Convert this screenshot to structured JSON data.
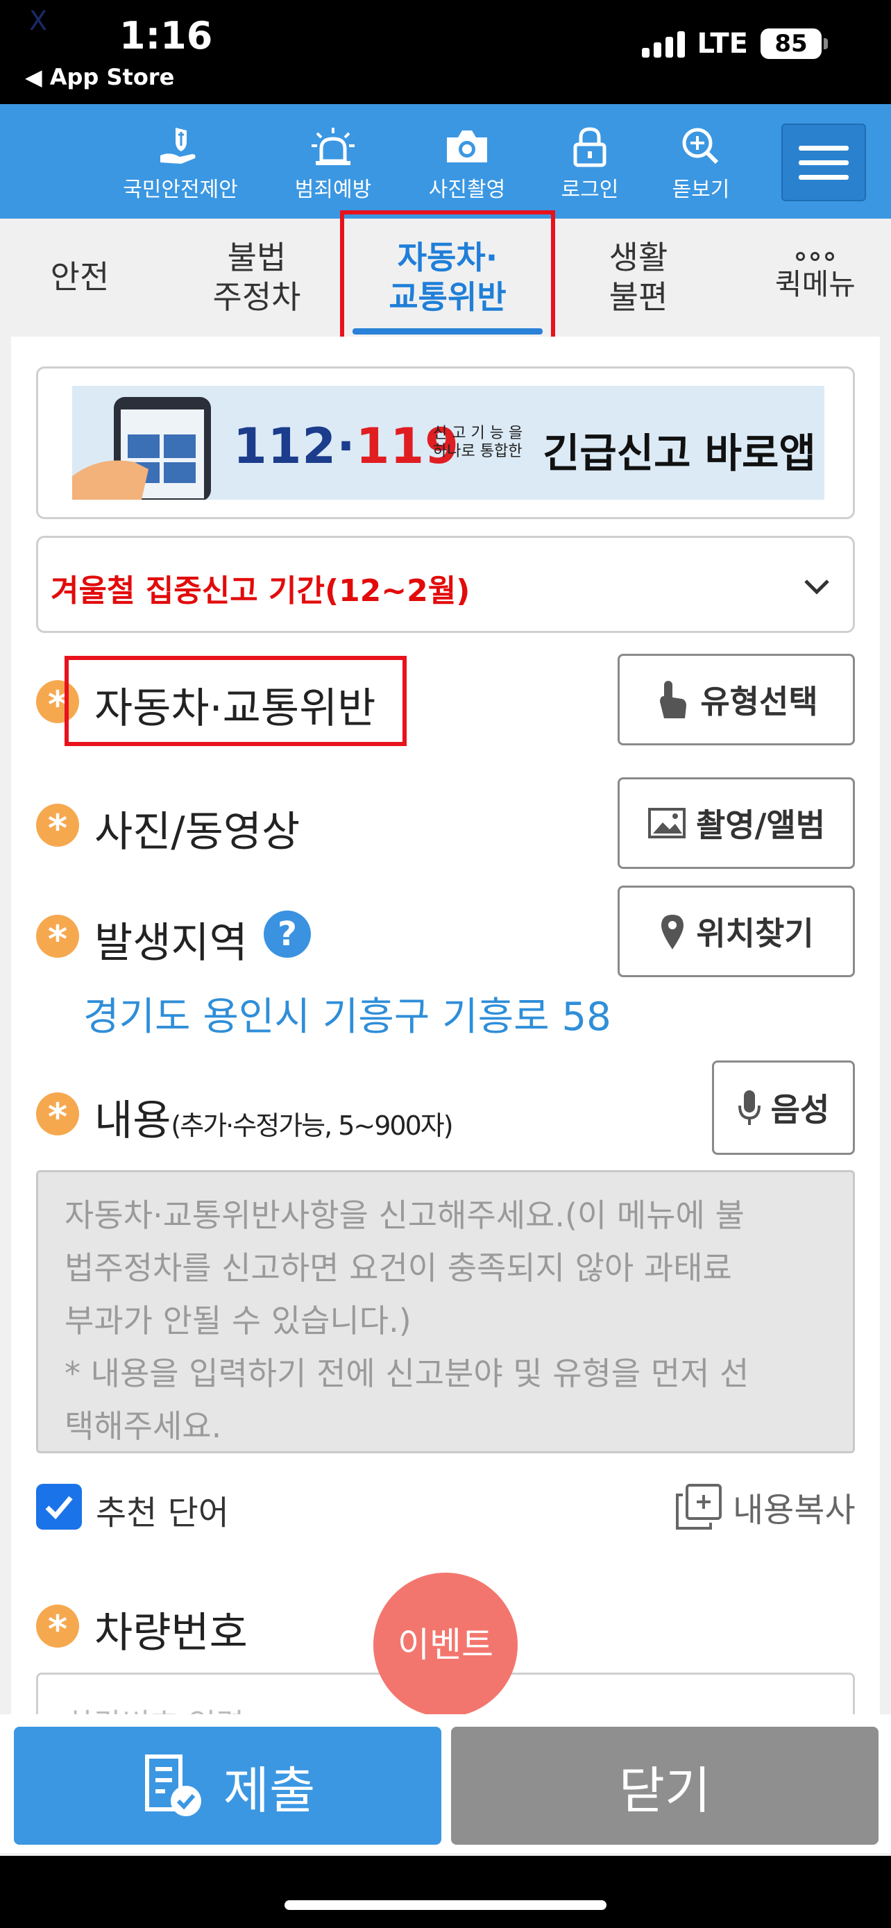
{
  "status_bar": {
    "time": "1:16",
    "back_label": "◀ App Store",
    "network": "LTE",
    "battery": "85",
    "corner_mark": "X"
  },
  "toolbar": {
    "items": [
      {
        "label": "국민안전제안",
        "icon": "hand-shield-icon"
      },
      {
        "label": "범죄예방",
        "icon": "siren-icon"
      },
      {
        "label": "사진촬영",
        "icon": "camera-icon"
      },
      {
        "label": "로그인",
        "icon": "lock-icon"
      },
      {
        "label": "돋보기",
        "icon": "magnifier-plus-icon"
      }
    ],
    "menu_icon": "hamburger-menu-icon"
  },
  "tabs": [
    {
      "label": "안전"
    },
    {
      "label_line1": "불법",
      "label_line2": "주정차"
    },
    {
      "label_line1": "자동차·",
      "label_line2": "교통위반",
      "active": true
    },
    {
      "label_line1": "생활",
      "label_line2": "불편"
    },
    {
      "label": "퀵메뉴",
      "icon": "more-dots-icon"
    }
  ],
  "banner": {
    "num1": "112·",
    "num2": "119",
    "small1": "신 고 기 능 을",
    "small2": "하나로 통합한",
    "title": "긴급신고 바로앱"
  },
  "notice": {
    "text": "겨울철 집중신고 기간(12~2월)"
  },
  "form": {
    "category": {
      "label": "자동차·교통위반",
      "button": "유형선택"
    },
    "media": {
      "label": "사진/동영상",
      "button": "촬영/앨범"
    },
    "location": {
      "label": "발생지역",
      "help": "?",
      "button": "위치찾기",
      "address": "경기도 용인시 기흥구 기흥로 58"
    },
    "content": {
      "label": "내용",
      "hint": "(추가·수정가능, 5~900자)",
      "button": "음성",
      "placeholder_line1": "자동차·교통위반사항을 신고해주세요.(이 메뉴에 불",
      "placeholder_line2": "법주정차를 신고하면 요건이 충족되지 않아 과태료",
      "placeholder_line3": "부과가 안될 수 있습니다.)",
      "placeholder_line4": "* 내용을 입력하기 전에 신고분야 및 유형을 먼저 선",
      "placeholder_line5": "택해주세요."
    },
    "recommend": {
      "label": "추천 단어",
      "checked": true
    },
    "copy": {
      "label": "내용복사"
    },
    "plate": {
      "label": "차량번호",
      "placeholder": "차량번호 입력"
    },
    "required_mark": "*"
  },
  "event_button": "이벤트",
  "bottom": {
    "submit": "제출",
    "close": "닫기"
  },
  "colors": {
    "primary": "#3b97e2",
    "highlight": "#e8121c",
    "required": "#f6a84f",
    "event": "#f3766e",
    "address": "#2f8ed8"
  }
}
